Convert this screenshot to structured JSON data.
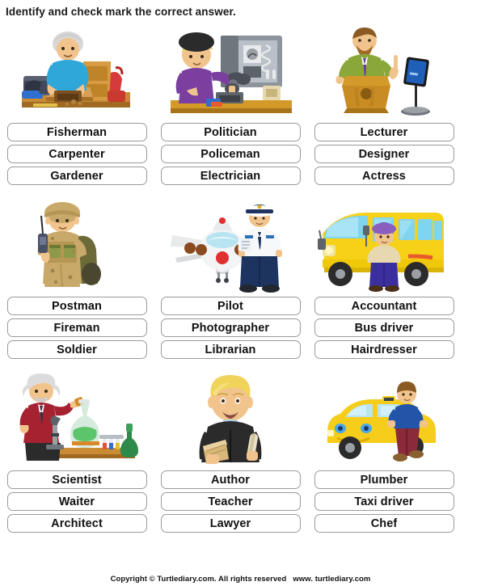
{
  "title": "Identify and check mark the correct answer.",
  "footer": {
    "copyright": "Copyright © Turtlediary.com. All rights reserved",
    "url": "www. turtlediary.com"
  },
  "questions": [
    {
      "image": "carpenter-working-at-workbench",
      "options": [
        "Fisherman",
        "Carpenter",
        "Gardener"
      ]
    },
    {
      "image": "electrician-working-on-electrical-panel",
      "options": [
        "Politician",
        "Policeman",
        "Electrician"
      ]
    },
    {
      "image": "lecturer-at-podium",
      "options": [
        "Lecturer",
        "Designer",
        "Actress"
      ]
    },
    {
      "image": "soldier-with-radio-and-backpack",
      "options": [
        "Postman",
        "Fireman",
        "Soldier"
      ]
    },
    {
      "image": "pilot-standing-beside-airplane",
      "options": [
        "Pilot",
        "Photographer",
        "Librarian"
      ]
    },
    {
      "image": "bus-driver-with-school-bus",
      "options": [
        "Accountant",
        "Bus driver",
        "Hairdresser"
      ]
    },
    {
      "image": "scientist-with-lab-equipment",
      "options": [
        "Scientist",
        "Waiter",
        "Architect"
      ]
    },
    {
      "image": "lawyer-in-robe-holding-documents",
      "options": [
        "Author",
        "Teacher",
        "Lawyer"
      ]
    },
    {
      "image": "taxi-driver-with-yellow-car",
      "options": [
        "Plumber",
        "Taxi driver",
        "Chef"
      ]
    }
  ],
  "colors": {
    "box_border": "#9a9a9a",
    "text": "#111111",
    "skin": "#f2c48d",
    "carpenter_shirt": "#2fa7d8",
    "carpenter_hair": "#d8d8d8",
    "wood": "#c98b34",
    "wood_dark": "#a06a22",
    "electrician_shirt": "#7b3fa0",
    "electrician_hair": "#ecd16a",
    "helmet": "#2b2b2b",
    "panel_grey": "#9aa0a6",
    "lecturer_jacket": "#8aa73a",
    "podium": "#d39a2a",
    "tablet": "#1f3f8f",
    "camo": "#c9a96a",
    "camo_dark": "#8e7640",
    "pilot_navy": "#1d3461",
    "bus_yellow": "#f7d117",
    "bus_window": "#7fd4ef",
    "scientist_red": "#a62231",
    "flask_green": "#5cc46a",
    "lawyer_robe": "#2b2b2b",
    "lawyer_hair": "#f0d35a",
    "taxi_yellow": "#f5cd1a",
    "taxi_shirt": "#2255a8"
  }
}
